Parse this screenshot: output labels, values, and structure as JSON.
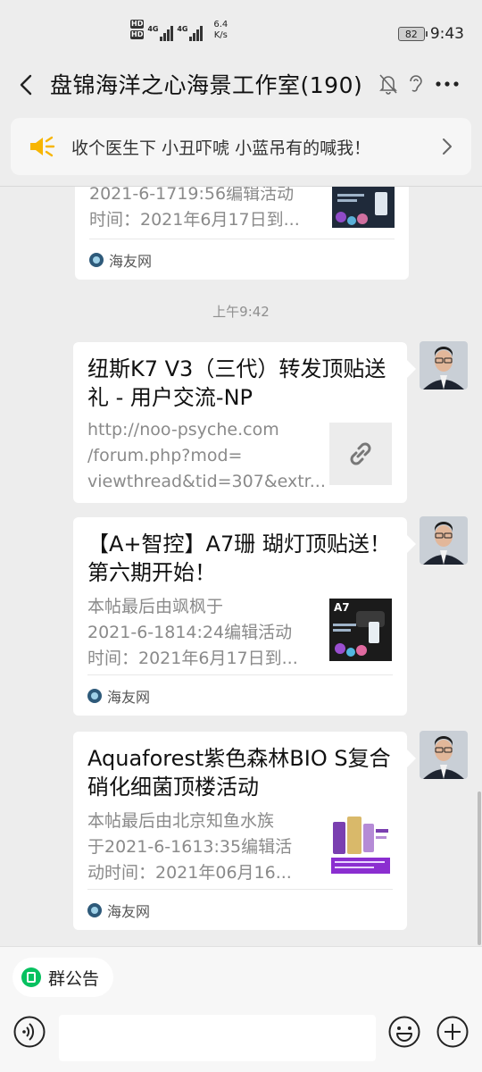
{
  "status_bar": {
    "hd_labels": [
      "HD",
      "HD"
    ],
    "network_labels": [
      "4G",
      "4G"
    ],
    "speed_value": "6.4",
    "speed_unit": "K/s",
    "battery": "82",
    "clock": "9:43"
  },
  "header": {
    "title": "盘锦海洋之心海景工作室(190)",
    "icons": [
      "back-icon",
      "mute-bell-icon",
      "ear-icon",
      "more-icon"
    ]
  },
  "notice": {
    "text": "收个医生下  小丑吓唬  小蓝吊有的喊我！",
    "icons": [
      "speaker-icon",
      "chevron-right-icon"
    ]
  },
  "messages": [
    {
      "desc": "2021-6-1719:56编辑活动\n时间：2021年6月17日到...",
      "source": "海友网"
    },
    {
      "time": "上午9:42"
    },
    {
      "title": "纽斯K7 V3（三代）转发顶贴送礼 - 用户交流-NP",
      "desc": "http://noo-psyche.com\n/forum.php?mod=\nviewthread&tid=307&extr...",
      "thumb": "link-icon"
    },
    {
      "title": "【A+智控】A7珊 瑚灯顶贴送！第六期开始！",
      "desc": "本帖最后由飒枫于\n2021-6-1814:24编辑活动\n时间：2021年6月17日到...",
      "thumb_label": "A7",
      "source": "海友网"
    },
    {
      "title": "Aquaforest紫色森林BIO S复合硝化细菌顶楼活动",
      "desc": "本帖最后由北京知鱼水族\n于2021-6-1613:35编辑活\n动时间：2021年06月16...",
      "source": "海友网"
    }
  ],
  "bottom": {
    "group_notice": "群公告",
    "input_value": "",
    "icons": [
      "voice-icon",
      "emoji-icon",
      "add-icon"
    ]
  },
  "colors": {
    "background": "#ededed",
    "card": "#ffffff",
    "accent_green": "#07c160",
    "speaker_yellow": "#f7b500"
  }
}
